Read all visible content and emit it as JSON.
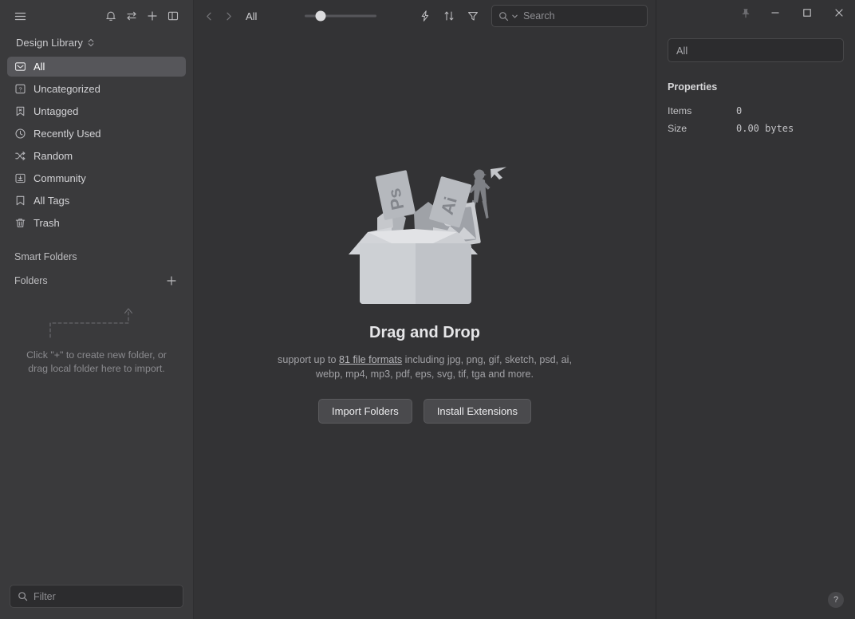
{
  "sidebar": {
    "top_icons": [
      {
        "name": "hamburger-menu-icon",
        "label": "Menu"
      },
      {
        "name": "bell-icon",
        "label": "Notifications"
      },
      {
        "name": "transfer-icon",
        "label": "Sync"
      },
      {
        "name": "plus-icon",
        "label": "Add"
      },
      {
        "name": "panel-toggle-icon",
        "label": "Toggle Panel"
      }
    ],
    "library_name": "Design Library",
    "nav_items": [
      {
        "label": "All",
        "icon": "inbox-icon",
        "selected": true
      },
      {
        "label": "Uncategorized",
        "icon": "question-box-icon",
        "selected": false
      },
      {
        "label": "Untagged",
        "icon": "bookmark-x-icon",
        "selected": false
      },
      {
        "label": "Recently Used",
        "icon": "clock-icon",
        "selected": false
      },
      {
        "label": "Random",
        "icon": "shuffle-icon",
        "selected": false
      },
      {
        "label": "Community",
        "icon": "box-download-icon",
        "selected": false
      },
      {
        "label": "All Tags",
        "icon": "bookmark-icon",
        "selected": false
      },
      {
        "label": "Trash",
        "icon": "trash-icon",
        "selected": false
      }
    ],
    "smart_folders_label": "Smart Folders",
    "folders_label": "Folders",
    "folders_hint_line1": "Click \"+\" to create new folder, or",
    "folders_hint_line2": "drag local folder here to import.",
    "filter_placeholder": "Filter",
    "filter_value": ""
  },
  "toolbar": {
    "back_label": "Back",
    "forward_label": "Forward",
    "breadcrumb": "All",
    "zoom_value": 22,
    "zoom_min": 0,
    "zoom_max": 100,
    "quick_icon": "lightning-icon",
    "sort_icon": "sort-icon",
    "filter_icon": "filter-funnel-icon",
    "search_placeholder": "Search",
    "search_value": ""
  },
  "empty_state": {
    "title": "Drag and Drop",
    "desc_prefix": "support up to ",
    "desc_link": "81 file formats",
    "desc_suffix": " including jpg, png, gif, sketch, psd, ai, webp, mp4, mp3, pdf, eps, svg, tif, tga and more.",
    "import_button": "Import Folders",
    "extensions_button": "Install Extensions"
  },
  "right_panel": {
    "pin_label": "Pin",
    "minimize_label": "Minimize",
    "maximize_label": "Maximize",
    "close_label": "Close",
    "title_value": "All",
    "properties_heading": "Properties",
    "properties": [
      {
        "key": "Items",
        "value": "0"
      },
      {
        "key": "Size",
        "value": "0.00 bytes"
      }
    ],
    "help_label": "?"
  },
  "colors": {
    "sidebar_bg": "#3a3a3c",
    "main_bg": "#333335",
    "selected_bg": "#56565a",
    "input_bg": "#2c2c2e",
    "text_primary": "#d6d6d8",
    "text_muted": "#8a8a8e"
  }
}
